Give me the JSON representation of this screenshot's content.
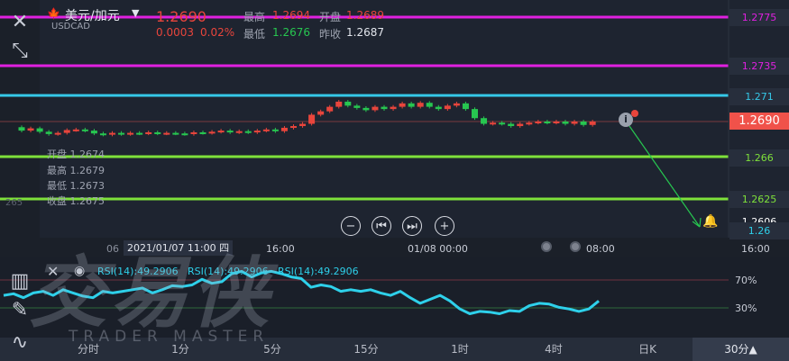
{
  "header": {
    "symbol_name": "美元/加元",
    "symbol_code": "USDCAD",
    "price": "1.2690",
    "change": "0.0003",
    "change_pct": "0.02%",
    "high_label": "最高",
    "high_value": "1.2694",
    "open_label": "开盘",
    "open_value": "1.2689",
    "low_label": "最低",
    "low_value": "1.2676",
    "prev_close_label": "昨收",
    "prev_close_value": "1.2687"
  },
  "price_levels": [
    {
      "label": "1.2775",
      "color": "#e020e0"
    },
    {
      "label": "1.2735",
      "color": "#e020e0"
    },
    {
      "label": "1.271",
      "color": "#35c8e8"
    },
    {
      "label": "1.266",
      "color": "#7ee13a"
    },
    {
      "label": "1.2625",
      "color": "#7ee13a"
    },
    {
      "label": "1.26",
      "color": "#2ed0ea"
    }
  ],
  "current_price_tag": "1.2690",
  "alert_price_tag": "1.2606",
  "crosshair_ohlc": {
    "open": "开盘 1.2674",
    "high": "最高 1.2679",
    "low": "最低 1.2673",
    "close": "收盘 1.2675"
  },
  "left_axis_value": "265",
  "time_axis": {
    "crosshair_date": "2021/01/07 11:00 四",
    "t1_prefix": "06",
    "t2": "16:00",
    "t3": "01/08 00:00",
    "t4": "08:00",
    "t5": "16:00"
  },
  "rsi": {
    "legend": [
      "RSI(14):49.2906",
      "RSI(14):49.2906",
      "RSI(14):49.2906"
    ],
    "level_high": "70%",
    "level_low": "30%",
    "values": [
      55,
      57,
      52,
      58,
      60,
      55,
      62,
      58,
      54,
      52,
      60,
      58,
      60,
      62,
      64,
      58,
      62,
      67,
      66,
      68,
      75,
      70,
      72,
      82,
      85,
      78,
      83,
      85,
      82,
      78,
      76,
      65,
      68,
      66,
      60,
      62,
      60,
      62,
      58,
      55,
      60,
      52,
      45,
      50,
      55,
      48,
      38,
      32,
      35,
      34,
      32,
      36,
      35,
      42,
      45,
      44,
      40,
      38,
      35,
      38,
      48
    ]
  },
  "colors": {
    "up": "#e8453c",
    "down": "#27c650",
    "rsi": "#2ed0ea",
    "bg": "#1e2430"
  },
  "toolbar_icons": [
    "close-icon",
    "collapse-icon",
    "candlestick-icon",
    "eye-icon",
    "draw-icon",
    "indicator-icon"
  ],
  "watermark_cn": "交易侠",
  "watermark_en": "TRADER MASTER",
  "timeframes": [
    {
      "label": "分时"
    },
    {
      "label": "1分"
    },
    {
      "label": "5分"
    },
    {
      "label": "15分"
    },
    {
      "label": "1时"
    },
    {
      "label": "4时"
    },
    {
      "label": "日K"
    },
    {
      "label": "30分▲",
      "active": true
    }
  ]
}
